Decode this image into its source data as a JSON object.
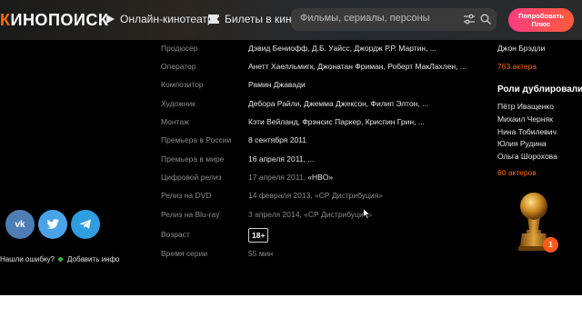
{
  "header": {
    "logo": "КИНОПОИСК",
    "nav": [
      {
        "label": "Онлайн-кинотеатр",
        "icon": "play-icon"
      },
      {
        "label": "Билеты в кино",
        "icon": "ticket-icon"
      }
    ],
    "search_placeholder": "Фильмы, сериалы, персоны",
    "plus_button": {
      "line1": "Попробовать",
      "line2": "Плюс"
    }
  },
  "details": [
    {
      "label": "Продюсер",
      "value": "Дэвид Бениофф, Д.Б. Уайсс, Джордж Р.Р. Мартин, ..."
    },
    {
      "label": "Оператор",
      "value": "Анетт Хаелльмигк, Джонатан Фриман, Роберт МакЛахлен, ..."
    },
    {
      "label": "Композитор",
      "value": "Рамин Джавади"
    },
    {
      "label": "Художник",
      "value": "Дебора Райли, Джемма Джексон, Филип Элтон, ..."
    },
    {
      "label": "Монтаж",
      "value": "Кэти Вейланд, Фрэнсис Паркер, Криспин Грин, ..."
    },
    {
      "label": "Премьера в России",
      "value": "8 сентября 2011"
    },
    {
      "label": "Премьера в мире",
      "value": "16 апреля 2011, ..."
    },
    {
      "label": "Цифровой релиз",
      "value_gray": "17 апреля 2011, ",
      "value_white": "«HBO»"
    },
    {
      "label": "Релиз на DVD",
      "value": "14 февраля 2013, «СР Дистрибуция»"
    },
    {
      "label": "Релиз на Blu-ray",
      "value": "3 апреля 2014, «СР Дистрибуция»"
    },
    {
      "label": "Возраст",
      "value": "18+"
    },
    {
      "label": "Время серии",
      "value": "55 мин"
    }
  ],
  "right_column": {
    "top_actor": "Джон Брэдли",
    "actors_count": "763 актера",
    "dub_heading": "Роли дублировали",
    "dub_actors": [
      "Пётр Иващенко",
      "Михаил Черняк",
      "Нина Тобилевич",
      "Юлия Рудина",
      "Ольга Шорохова"
    ],
    "dub_count": "60 актеров"
  },
  "social": {
    "vk": "vk",
    "error_link": "Нашли ошибку?",
    "add_info": "Добавить инфо"
  },
  "award_badge": "1",
  "colors": {
    "accent": "#ff6a00",
    "plus_gradient_start": "#ff3d7f",
    "plus_gradient_end": "#ff5a3c"
  }
}
